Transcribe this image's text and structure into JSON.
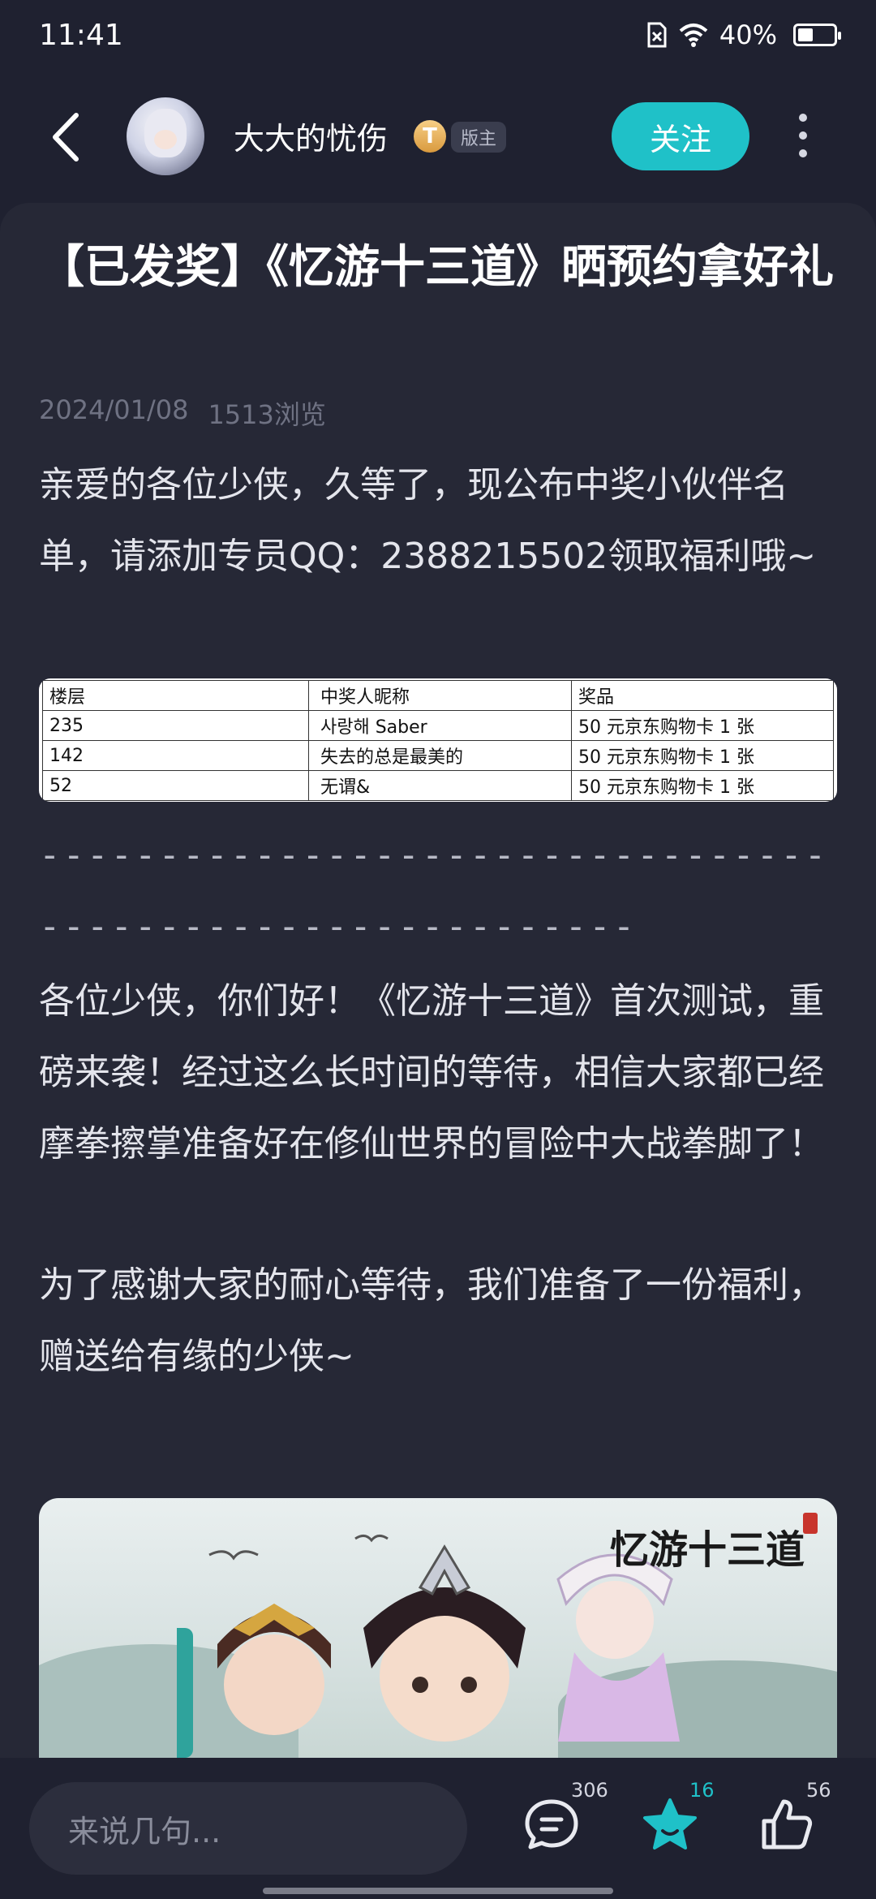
{
  "status_bar": {
    "time": "11:41",
    "battery_percent": "40%"
  },
  "header": {
    "username": "大大的忧伤",
    "level_badge": "T",
    "role_badge": "版主",
    "follow_label": "关注"
  },
  "post": {
    "title": "【已发奖】《忆游十三道》晒预约拿好礼",
    "date": "2024/01/08",
    "views": "1513浏览",
    "para1": "亲爱的各位少侠，久等了，现公布中奖小伙伴名单，请添加专员QQ：2388215502领取福利哦~",
    "divider": "----------------------------------------------------------",
    "para2": "各位少侠，你们好！《忆游十三道》首次测试，重磅来袭！经过这么长时间的等待，相信大家都已经摩拳擦掌准备好在修仙世界的冒险中大战拳脚了！",
    "para3": "为了感谢大家的耐心等待，我们准备了一份福利，赠送给有缘的少侠~"
  },
  "winners_table": {
    "headers": [
      "楼层",
      "中奖人昵称",
      "奖品"
    ],
    "rows": [
      [
        "235",
        "사랑해 Saber",
        "50 元京东购物卡 1 张"
      ],
      [
        "142",
        "失去的总是最美的",
        "50 元京东购物卡 1 张"
      ],
      [
        "52",
        "无谓&",
        "50 元京东购物卡 1 张"
      ]
    ]
  },
  "banner": {
    "logo_text": "忆游十三道"
  },
  "bottom_bar": {
    "comment_placeholder": "来说几句...",
    "comment_count": "306",
    "collect_count": "16",
    "like_count": "56"
  },
  "colors": {
    "accent": "#1fc1c8",
    "background": "#1f2130",
    "card": "#262836"
  }
}
